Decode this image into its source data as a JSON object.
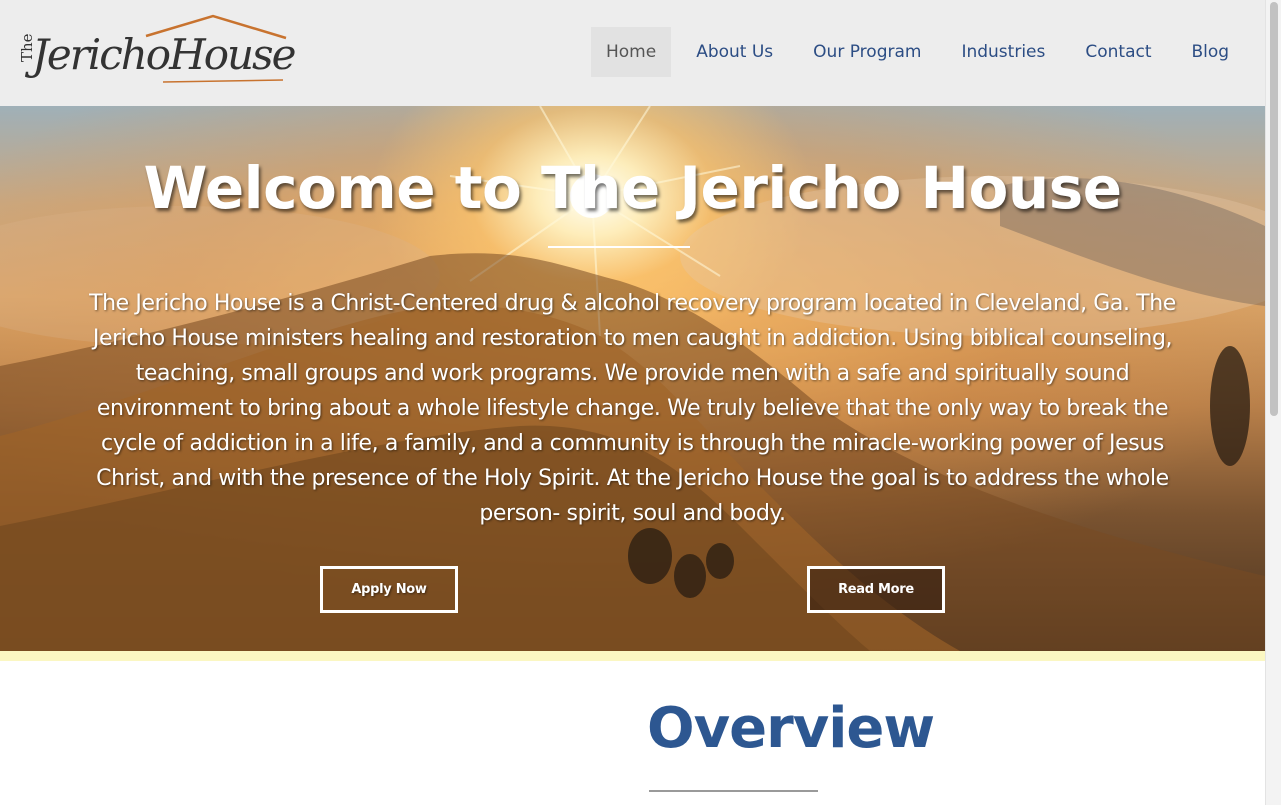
{
  "logo": {
    "the": "The",
    "jericho": "Jericho",
    "house": "House",
    "roof_color": "#c8732f"
  },
  "nav": {
    "items": [
      {
        "label": "Home",
        "active": true
      },
      {
        "label": "About Us"
      },
      {
        "label": "Our Program"
      },
      {
        "label": "Industries"
      },
      {
        "label": "Contact"
      },
      {
        "label": "Blog"
      }
    ]
  },
  "hero": {
    "title": "Welcome to The Jericho House",
    "body": "The Jericho House is a Christ-Centered drug & alcohol recovery program located in Cleveland, Ga. The Jericho House ministers healing and restoration to men caught in addiction. Using biblical counseling, teaching, small groups and work programs. We provide men with a safe and spiritually sound environment to bring about a whole lifestyle change. We truly believe that the only way to break the cycle of addiction in a life, a family, and a community is through the miracle-working power of Jesus Christ, and with the presence of the Holy Spirit. At the Jericho House the goal is to address the whole person- spirit, soul and body.",
    "apply_label": "Apply Now",
    "read_label": "Read More"
  },
  "overview": {
    "title": "Overview"
  },
  "colors": {
    "nav_link": "#2c4d84",
    "overview_title": "#2d5791",
    "band": "#fbf7c2"
  }
}
